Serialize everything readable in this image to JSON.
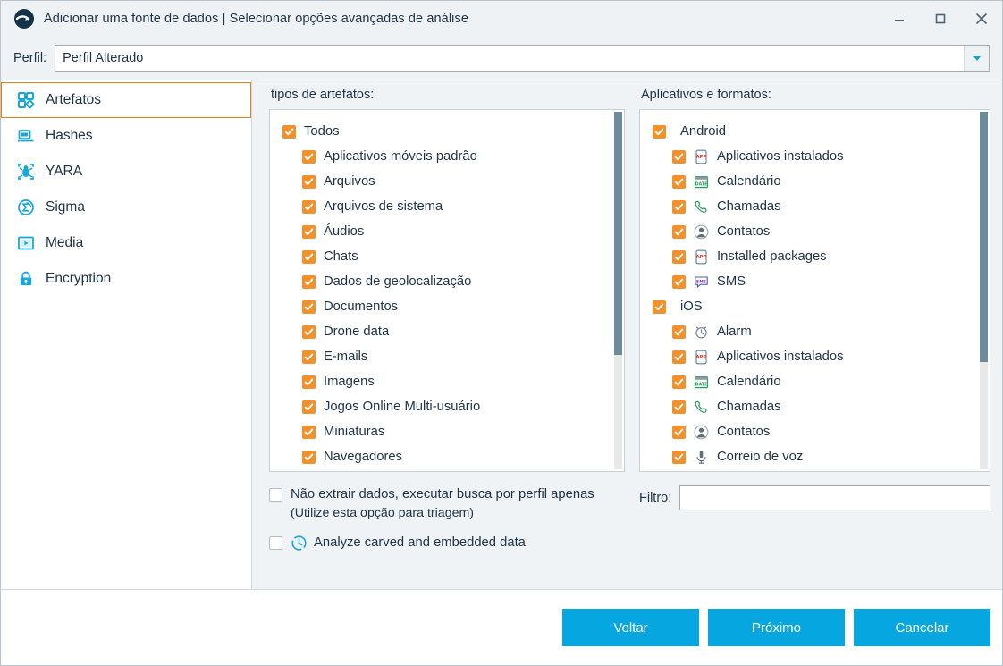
{
  "window": {
    "title": "Adicionar uma fonte de dados | Selecionar opções avançadas de análise",
    "app_icon": "autopsy-logo-icon",
    "controls": {
      "minimize": "minimize-icon",
      "maximize": "maximize-icon",
      "close": "close-icon"
    }
  },
  "profile": {
    "label": "Perfil:",
    "value": "Perfil Alterado",
    "placeholder": ""
  },
  "sidebar": {
    "items": [
      {
        "label": "Artefatos",
        "icon": "artifacts-icon",
        "active": true
      },
      {
        "label": "Hashes",
        "icon": "hashes-icon",
        "active": false
      },
      {
        "label": "YARA",
        "icon": "yara-icon",
        "active": false
      },
      {
        "label": "Sigma",
        "icon": "sigma-icon",
        "active": false
      },
      {
        "label": "Media",
        "icon": "media-icon",
        "active": false
      },
      {
        "label": "Encryption",
        "icon": "encryption-icon",
        "active": false
      }
    ]
  },
  "artifact_types": {
    "heading": "tipos de artefatos:",
    "scroll_thumb_top_pct": 0,
    "scroll_thumb_height_pct": 68,
    "items": [
      {
        "label": "Todos",
        "checked": true,
        "level": 0
      },
      {
        "label": "Aplicativos móveis padrão",
        "checked": true,
        "level": 1
      },
      {
        "label": "Arquivos",
        "checked": true,
        "level": 1
      },
      {
        "label": "Arquivos de sistema",
        "checked": true,
        "level": 1
      },
      {
        "label": "Áudios",
        "checked": true,
        "level": 1
      },
      {
        "label": "Chats",
        "checked": true,
        "level": 1
      },
      {
        "label": "Dados de geolocalização",
        "checked": true,
        "level": 1
      },
      {
        "label": "Documentos",
        "checked": true,
        "level": 1
      },
      {
        "label": "Drone data",
        "checked": true,
        "level": 1
      },
      {
        "label": "E-mails",
        "checked": true,
        "level": 1
      },
      {
        "label": "Imagens",
        "checked": true,
        "level": 1
      },
      {
        "label": "Jogos Online Multi-usuário",
        "checked": true,
        "level": 1
      },
      {
        "label": "Miniaturas",
        "checked": true,
        "level": 1
      },
      {
        "label": "Navegadores",
        "checked": true,
        "level": 1
      }
    ]
  },
  "apps_formats": {
    "heading": "Aplicativos e formatos:",
    "scroll_thumb_top_pct": 0,
    "scroll_thumb_height_pct": 70,
    "items": [
      {
        "label": "Android",
        "checked": true,
        "level": 0,
        "icon": ""
      },
      {
        "label": "Aplicativos instalados",
        "checked": true,
        "level": 1,
        "icon": "app-icon"
      },
      {
        "label": "Calendário",
        "checked": true,
        "level": 1,
        "icon": "calendar-icon"
      },
      {
        "label": "Chamadas",
        "checked": true,
        "level": 1,
        "icon": "phone-icon"
      },
      {
        "label": "Contatos",
        "checked": true,
        "level": 1,
        "icon": "contact-icon"
      },
      {
        "label": "Installed packages",
        "checked": true,
        "level": 1,
        "icon": "app-icon"
      },
      {
        "label": "SMS",
        "checked": true,
        "level": 1,
        "icon": "sms-icon"
      },
      {
        "label": "iOS",
        "checked": true,
        "level": 0,
        "icon": ""
      },
      {
        "label": "Alarm",
        "checked": true,
        "level": 1,
        "icon": "alarm-icon"
      },
      {
        "label": "Aplicativos instalados",
        "checked": true,
        "level": 1,
        "icon": "app-icon"
      },
      {
        "label": "Calendário",
        "checked": true,
        "level": 1,
        "icon": "calendar-icon"
      },
      {
        "label": "Chamadas",
        "checked": true,
        "level": 1,
        "icon": "phone-icon"
      },
      {
        "label": "Contatos",
        "checked": true,
        "level": 1,
        "icon": "contact-icon"
      },
      {
        "label": "Correio de voz",
        "checked": true,
        "level": 1,
        "icon": "voicemail-icon"
      }
    ]
  },
  "options": {
    "no_extract": {
      "label": "Não extrair dados, executar busca por perfil apenas",
      "sublabel": "(Utilize esta opção para triagem)",
      "checked": false
    },
    "analyze_carved": {
      "label": "Analyze carved and embedded data",
      "icon": "carved-data-clock-icon",
      "checked": false
    }
  },
  "filter": {
    "label": "Filtro:",
    "value": "",
    "placeholder": ""
  },
  "footer": {
    "back": "Voltar",
    "next": "Próximo",
    "cancel": "Cancelar"
  },
  "colors": {
    "accent_blue": "#06a7e0",
    "checkbox_orange": "#f0912c",
    "selection_border": "#e08214",
    "content_bg": "#eff3f6",
    "text": "#1e3246"
  }
}
